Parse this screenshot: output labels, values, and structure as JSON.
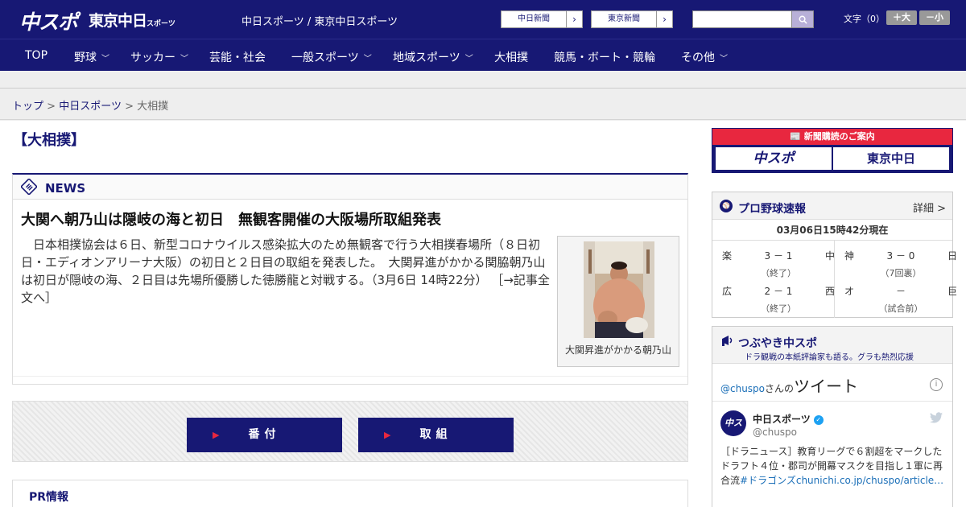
{
  "header": {
    "logo_chuspo": "中スポ",
    "logo_tokyo": "東京中日",
    "logo_tokyo_small": "スポーツ",
    "site_name": "中日スポーツ / 東京中日スポーツ",
    "ext_links": [
      "中日新聞",
      "東京新聞"
    ],
    "search_placeholder": "",
    "font_label": "文字（0）",
    "font_bigger": "＋大",
    "font_smaller": "－小"
  },
  "nav": {
    "items": [
      {
        "label": "TOP",
        "has_menu": false
      },
      {
        "label": "野球",
        "has_menu": true
      },
      {
        "label": "サッカー",
        "has_menu": true
      },
      {
        "label": "芸能・社会",
        "has_menu": false
      },
      {
        "label": "一般スポーツ",
        "has_menu": true
      },
      {
        "label": "地域スポーツ",
        "has_menu": true
      },
      {
        "label": "大相撲",
        "has_menu": false
      },
      {
        "label": "競馬・ボート・競輪",
        "has_menu": false
      },
      {
        "label": "その他",
        "has_menu": true
      }
    ]
  },
  "breadcrumb": {
    "top": "トップ",
    "sep": ">",
    "chunichi": "中日スポーツ",
    "current": "大相撲"
  },
  "page_title": "【大相撲】",
  "news": {
    "label": "NEWS",
    "headline": "大関へ朝乃山は隠岐の海と初日　無観客開催の大阪場所取組発表",
    "body": "　日本相撲協会は６日、新型コロナウイルス感染拡大のため無観客で行う大相撲春場所（８日初日・エディオンアリーナ大阪）の初日と２日目の取組を発表した。　大関昇進がかかる関脇朝乃山は初日が隠岐の海、２日目は先場所優勝した徳勝龍と対戦する。（3月6日 14時22分）",
    "more": "［→記事全文へ］",
    "photo_caption": "大関昇進がかかる朝乃山"
  },
  "buttons": {
    "banzuke": "番付",
    "torikumi": "取組"
  },
  "pr": {
    "label": "PR情報"
  },
  "sidebar": {
    "subscribe": {
      "title": "新聞購読のご案内",
      "logo_a": "中スポ",
      "logo_b": "東京中日"
    },
    "baseball": {
      "title": "プロ野球速報",
      "detail": "詳細 >",
      "time": "03月06日15時42分現在",
      "games": [
        {
          "home": "楽",
          "score": "3 － 1",
          "away": "中",
          "status": "（終了）"
        },
        {
          "home": "神",
          "score": "3 － 0",
          "away": "日",
          "status": "（7回裏）"
        },
        {
          "home": "広",
          "score": "2 － 1",
          "away": "西",
          "status": "（終了）"
        },
        {
          "home": "オ",
          "score": "－",
          "away": "巨",
          "status": "（試合前）"
        }
      ]
    },
    "twitter": {
      "title": "つぶやき中スポ",
      "subtitle": "ドラ観戦の本紙評論家も語る。グラも熱烈応援",
      "user_handle": "@chuspo",
      "user_suffix": "さんの",
      "tweets_label": "ツイート",
      "info": "i",
      "avatar": "中スポ",
      "name": "中日スポーツ",
      "verified": "✓",
      "handle": "@chuspo",
      "text": "［ドラニュース］教育リーグで６割超をマークしたドラフト４位・郡司が開幕マスクを目指し１軍に再合流",
      "hashtag": "#ドラゴンズ",
      "link": "chunichi.co.jp/chuspo/article…"
    }
  },
  "colors": {
    "brand_navy": "#171874",
    "accent_red": "#e8273f",
    "link_blue": "#1b6fb8"
  }
}
